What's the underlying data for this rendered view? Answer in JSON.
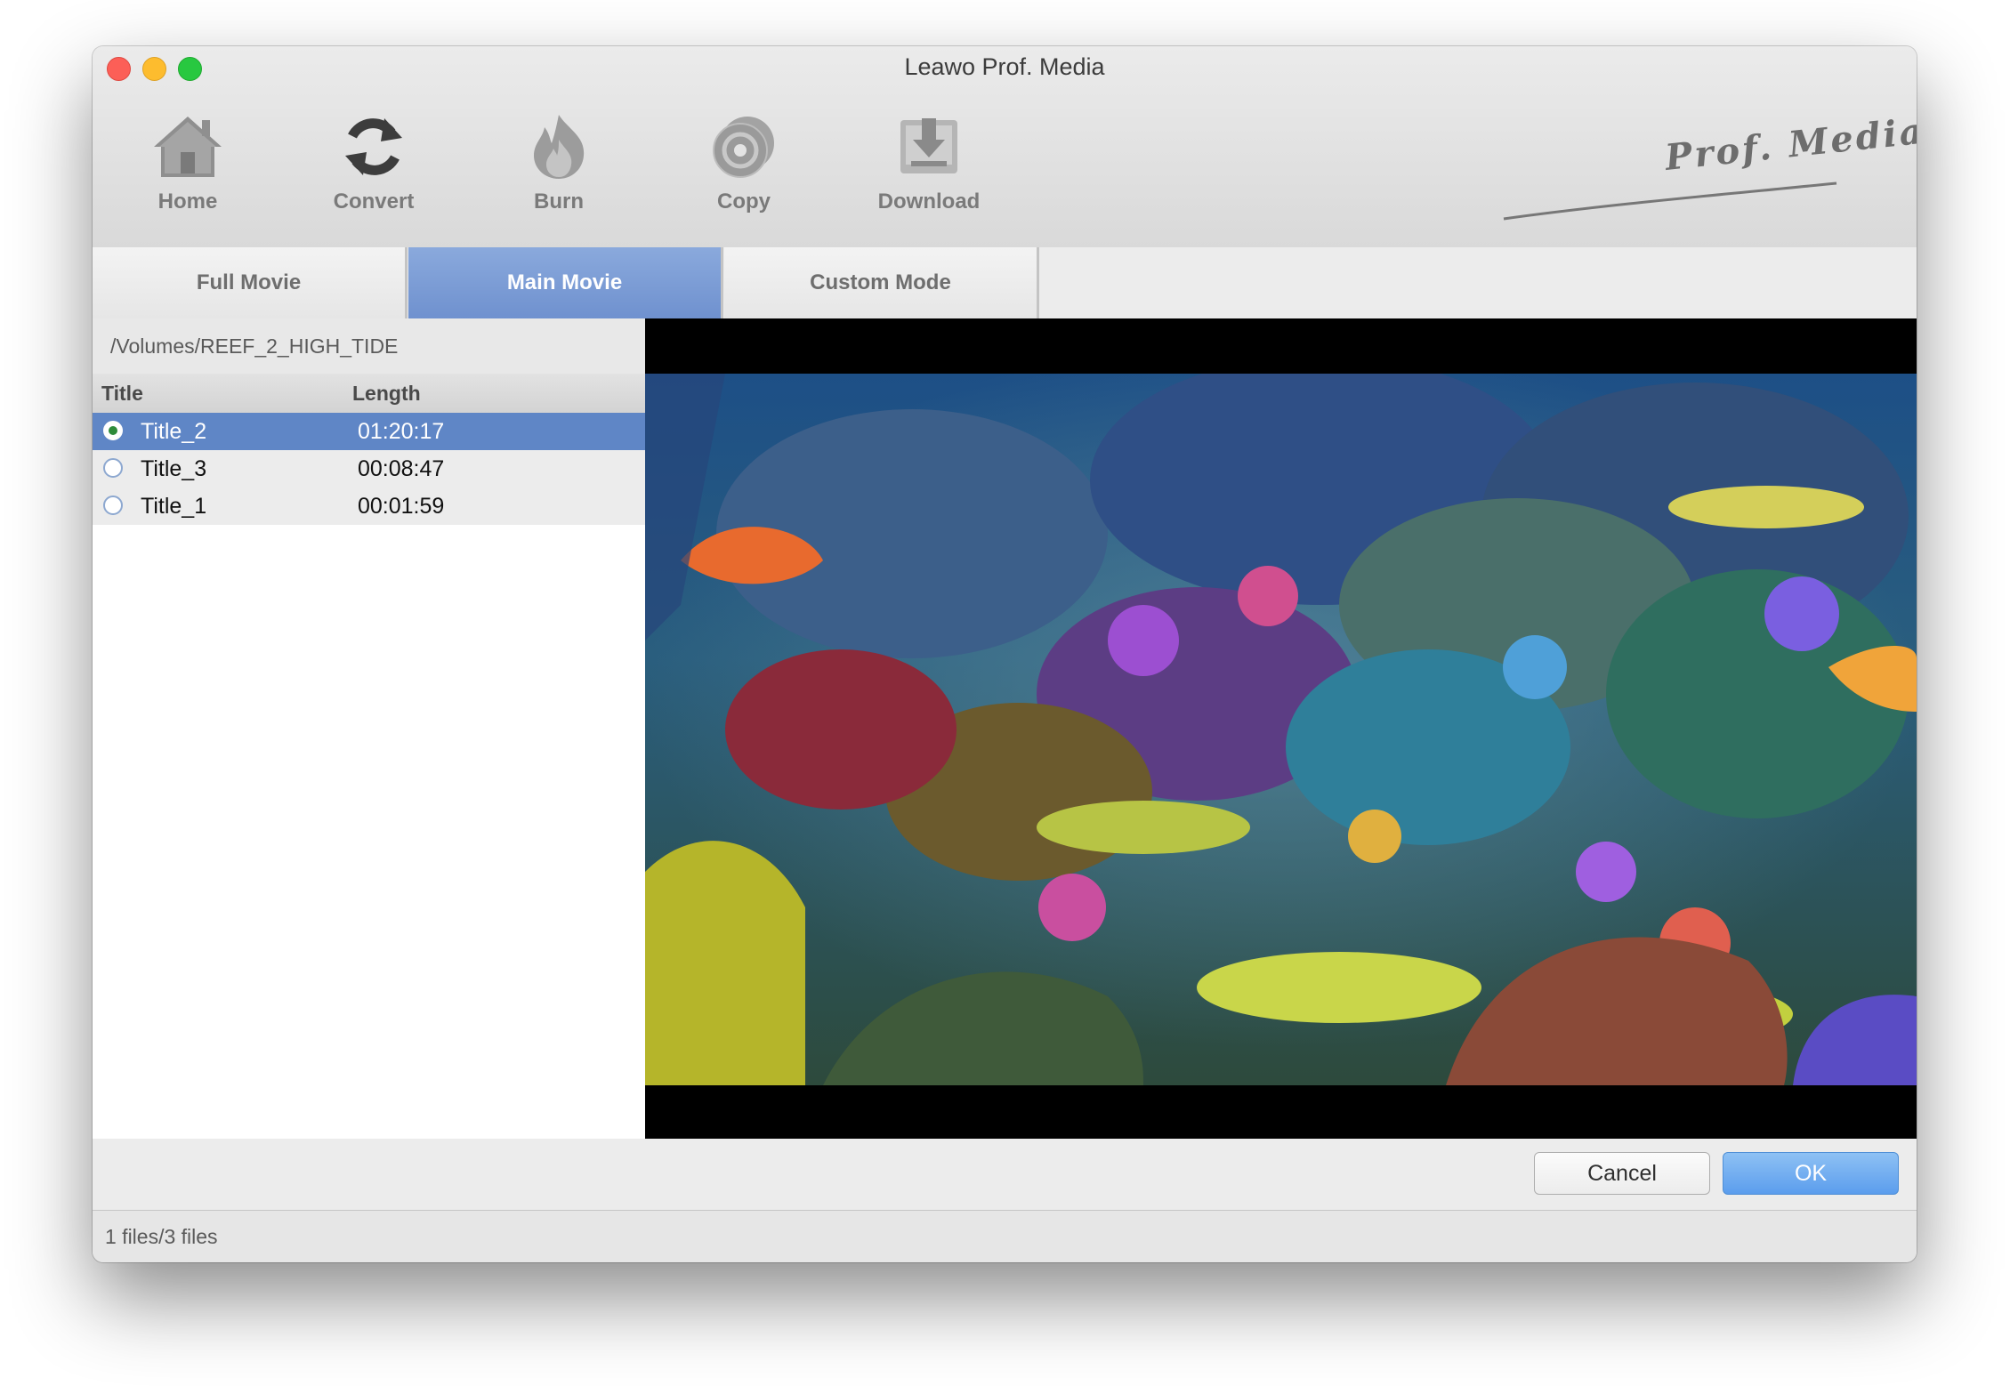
{
  "window": {
    "title": "Leawo Prof. Media"
  },
  "toolbar": {
    "items": [
      {
        "label": "Home",
        "icon": "home-icon"
      },
      {
        "label": "Convert",
        "icon": "convert-icon"
      },
      {
        "label": "Burn",
        "icon": "flame-icon"
      },
      {
        "label": "Copy",
        "icon": "disc-icon"
      },
      {
        "label": "Download",
        "icon": "download-icon"
      }
    ],
    "brand": "Prof. Media"
  },
  "tabs": [
    {
      "label": "Full Movie",
      "active": false
    },
    {
      "label": "Main Movie",
      "active": true
    },
    {
      "label": "Custom Mode",
      "active": false
    }
  ],
  "source": {
    "path": "/Volumes/REEF_2_HIGH_TIDE"
  },
  "titles": {
    "columns": [
      "Title",
      "Length"
    ],
    "rows": [
      {
        "title": "Title_2",
        "length": "01:20:17",
        "selected": true
      },
      {
        "title": "Title_3",
        "length": "00:08:47",
        "selected": false
      },
      {
        "title": "Title_1",
        "length": "00:01:59",
        "selected": false
      }
    ]
  },
  "buttons": {
    "cancel": "Cancel",
    "ok": "OK"
  },
  "status": {
    "text": "1 files/3 files"
  },
  "colors": {
    "accent": "#5f86c6",
    "ok_button": "#5b9ded",
    "tab_active": "#7a9bd4"
  }
}
